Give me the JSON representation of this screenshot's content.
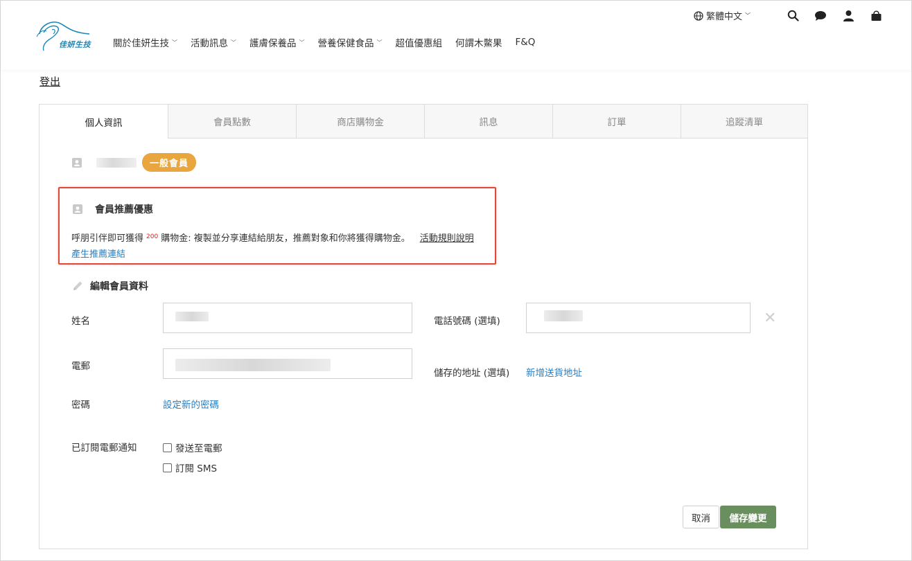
{
  "header": {
    "logo_text": "佳妍生技",
    "nav": [
      {
        "label": "關於佳妍生技",
        "has_dropdown": true
      },
      {
        "label": "活動訊息",
        "has_dropdown": true
      },
      {
        "label": "護膚保養品",
        "has_dropdown": true
      },
      {
        "label": "營養保健食品",
        "has_dropdown": true
      },
      {
        "label": "超值優惠組",
        "has_dropdown": false
      },
      {
        "label": "何謂木鱉果",
        "has_dropdown": false
      },
      {
        "label": "F&Q",
        "has_dropdown": false
      }
    ],
    "language": "繁體中文",
    "icons": [
      "globe-icon",
      "search-icon",
      "chat-icon",
      "user-icon",
      "cart-icon"
    ]
  },
  "logout_label": "登出",
  "tabs": [
    {
      "label": "個人資訊",
      "active": true
    },
    {
      "label": "會員點數",
      "active": false
    },
    {
      "label": "商店購物金",
      "active": false
    },
    {
      "label": "訊息",
      "active": false
    },
    {
      "label": "訂單",
      "active": false
    },
    {
      "label": "追蹤清單",
      "active": false
    }
  ],
  "member": {
    "badge": "一般會員"
  },
  "referral": {
    "title": "會員推薦優惠",
    "desc_prefix": "呼朋引伴即可獲得",
    "amount": "200",
    "desc_suffix": "購物金: 複製並分享連結給朋友，推薦對象和你將獲得購物金。",
    "rules_link": "活動規則說明",
    "generate_link": "產生推薦連結"
  },
  "edit": {
    "title": "編輯會員資料",
    "name_label": "姓名",
    "phone_label": "電話號碼 (選填)",
    "email_label": "電郵",
    "address_label": "儲存的地址 (選填)",
    "address_link": "新增送貨地址",
    "password_label": "密碼",
    "password_link": "設定新的密碼",
    "subscription_label": "已訂閱電郵通知",
    "subscribe_email": "發送至電郵",
    "subscribe_sms": "訂閱 SMS",
    "cancel_button": "取消",
    "save_button": "儲存變更"
  },
  "colors": {
    "accent_link": "#2a7fc1",
    "badge": "#e9a63e",
    "save_button": "#6a8f5e",
    "highlight_border": "#e0483a",
    "amount": "#d8241c"
  }
}
